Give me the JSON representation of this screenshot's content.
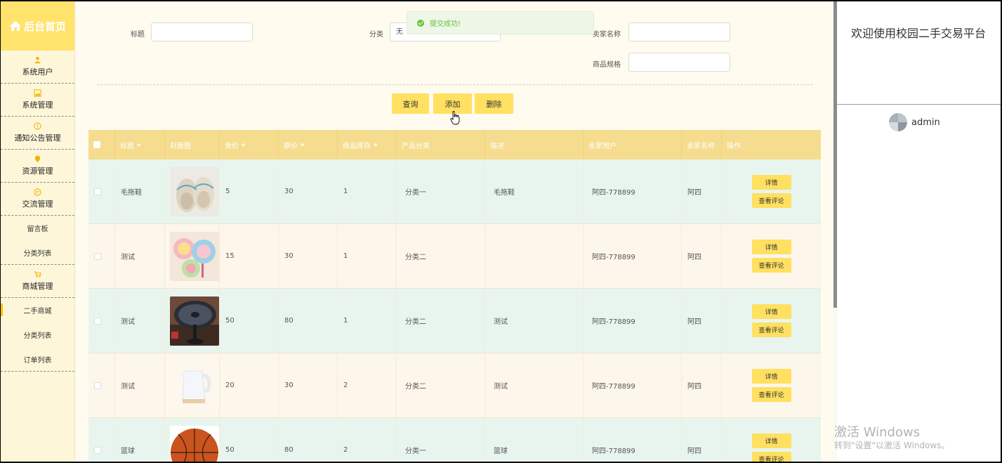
{
  "sidebar": {
    "title": "后台首页",
    "groups": [
      {
        "label": "系统用户",
        "icon": "user-icon"
      },
      {
        "label": "系统管理",
        "icon": "image-icon"
      },
      {
        "label": "通知公告管理",
        "icon": "info-icon"
      },
      {
        "label": "资源管理",
        "icon": "pin-icon"
      },
      {
        "label": "交流管理",
        "icon": "chat-icon"
      }
    ],
    "sub_items_1": [
      {
        "label": "留言板"
      },
      {
        "label": "分类列表"
      }
    ],
    "shop_group": {
      "label": "商城管理",
      "icon": "cart-icon"
    },
    "sub_items_2": [
      {
        "label": "二手商城",
        "active": true
      },
      {
        "label": "分类列表"
      },
      {
        "label": "订单列表"
      }
    ]
  },
  "filters": {
    "title_label": "标题",
    "title_value": "",
    "category_label": "分类",
    "category_value": "无",
    "seller_name_label": "卖家名称",
    "seller_name_value": "",
    "spec_label": "商品规格",
    "spec_value": ""
  },
  "toast": {
    "text": "提交成功!",
    "icon": "check-circle-icon"
  },
  "buttons": {
    "query": "查询",
    "add": "添加",
    "delete": "删除"
  },
  "table": {
    "headers": [
      "标题",
      "封面图",
      "卖价",
      "原价",
      "商品库存",
      "产品分类",
      "描述",
      "卖家用户",
      "卖家名称",
      "操作"
    ],
    "rows": [
      {
        "title": "毛拖鞋",
        "image": "slippers",
        "price": "5",
        "original": "30",
        "stock": "1",
        "category": "分类一",
        "desc": "毛拖鞋",
        "seller_user": "阿四-778899",
        "seller_name": "阿四"
      },
      {
        "title": "测试",
        "image": "fans",
        "price": "15",
        "original": "30",
        "stock": "1",
        "category": "分类二",
        "desc": "",
        "seller_user": "阿四-778899",
        "seller_name": "阿四"
      },
      {
        "title": "测试",
        "image": "desk-fan",
        "price": "50",
        "original": "80",
        "stock": "1",
        "category": "分类二",
        "desc": "测试",
        "seller_user": "阿四-778899",
        "seller_name": "阿四"
      },
      {
        "title": "测试",
        "image": "kettle",
        "price": "20",
        "original": "30",
        "stock": "2",
        "category": "分类二",
        "desc": "测试",
        "seller_user": "阿四-778899",
        "seller_name": "阿四"
      },
      {
        "title": "篮球",
        "image": "basketball",
        "price": "50",
        "original": "80",
        "stock": "2",
        "category": "分类一",
        "desc": "篮球",
        "seller_user": "阿四-778899",
        "seller_name": "阿四"
      }
    ],
    "detail_label": "详情",
    "comments_label": "查看评论"
  },
  "right_panel": {
    "welcome": "欢迎使用校园二手交易平台",
    "username": "admin"
  },
  "watermark": {
    "line1": "激活 Windows",
    "line2": "转到\"设置\"以激活 Windows。"
  }
}
